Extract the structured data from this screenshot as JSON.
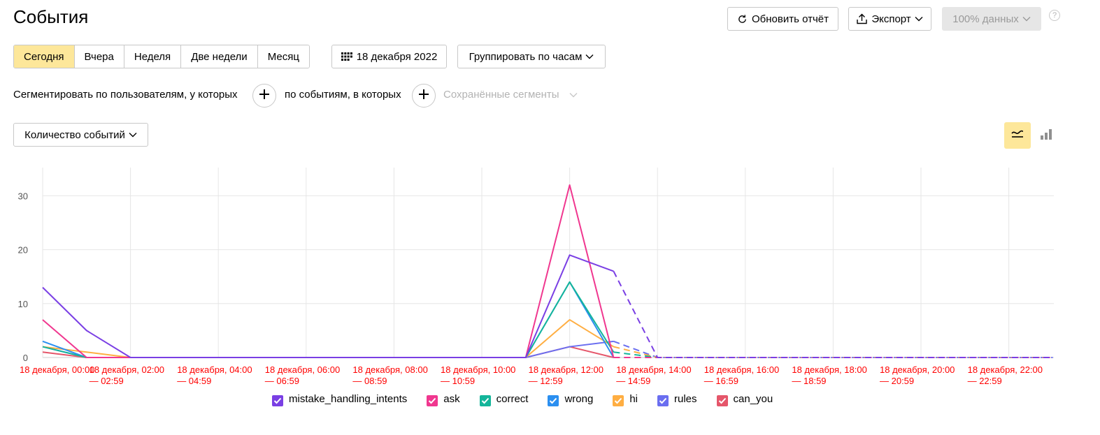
{
  "page_title": "События",
  "header": {
    "refresh_label": "Обновить отчёт",
    "export_label": "Экспорт",
    "sampling_label": "100% данных",
    "help_icon": "?"
  },
  "periods": [
    "Сегодня",
    "Вчера",
    "Неделя",
    "Две недели",
    "Месяц"
  ],
  "active_period": "Сегодня",
  "date_label": "18 декабря 2022",
  "group_label": "Группировать по часам",
  "segment": {
    "users_text": "Сегментировать по пользователям, у которых",
    "events_text": "по событиям, в которых",
    "saved_segments": "Сохранённые сегменты"
  },
  "metric_label": "Количество событий",
  "colors": {
    "accent": "#fde79a",
    "mistake_handling_intents": "#7a3fe4",
    "ask": "#f0378f",
    "correct": "#14b59a",
    "wrong": "#2b8ff0",
    "hi": "#ffae42",
    "rules": "#6a6ef0",
    "can_you": "#e5566a",
    "tick_label": "#ff0000"
  },
  "chart_data": {
    "type": "line",
    "ylim": [
      0,
      35
    ],
    "y_ticks": [
      0,
      10,
      20,
      30
    ],
    "grid": true,
    "legend_position": "bottom",
    "x": [
      0,
      1,
      2,
      3,
      4,
      5,
      6,
      7,
      8,
      9,
      10,
      11,
      12,
      13,
      14,
      15,
      16,
      17,
      18,
      19,
      20,
      21,
      22,
      23
    ],
    "x_tick_labels": [
      [
        "18 декабря, 00:00",
        ""
      ],
      [
        "18 декабря, 02:00",
        "— 02:59"
      ],
      [
        "18 декабря, 04:00",
        "— 04:59"
      ],
      [
        "18 декабря, 06:00",
        "— 06:59"
      ],
      [
        "18 декабря, 08:00",
        "— 08:59"
      ],
      [
        "18 декабря, 10:00",
        "— 10:59"
      ],
      [
        "18 декабря, 12:00",
        "— 12:59"
      ],
      [
        "18 декабря, 14:00",
        "— 14:59"
      ],
      [
        "18 декабря, 16:00",
        "— 16:59"
      ],
      [
        "18 декабря, 18:00",
        "— 18:59"
      ],
      [
        "18 декабря, 20:00",
        "— 20:59"
      ],
      [
        "18 декабря, 22:00",
        "— 22:59"
      ]
    ],
    "dashed_from_index": 13,
    "series": [
      {
        "name": "mistake_handling_intents",
        "values": [
          13,
          5,
          0,
          0,
          0,
          0,
          0,
          0,
          0,
          0,
          0,
          0,
          19,
          16,
          0,
          0,
          0,
          0,
          0,
          0,
          0,
          0,
          0,
          0
        ]
      },
      {
        "name": "ask",
        "values": [
          7,
          0,
          0,
          0,
          0,
          0,
          0,
          0,
          0,
          0,
          0,
          0,
          32,
          0,
          0,
          0,
          0,
          0,
          0,
          0,
          0,
          0,
          0,
          0
        ]
      },
      {
        "name": "correct",
        "values": [
          2,
          0,
          0,
          0,
          0,
          0,
          0,
          0,
          0,
          0,
          0,
          0,
          14,
          1,
          0,
          0,
          0,
          0,
          0,
          0,
          0,
          0,
          0,
          0
        ]
      },
      {
        "name": "wrong",
        "values": [
          3,
          0,
          0,
          0,
          0,
          0,
          0,
          0,
          0,
          0,
          0,
          0,
          14,
          0,
          0,
          0,
          0,
          0,
          0,
          0,
          0,
          0,
          0,
          0
        ]
      },
      {
        "name": "hi",
        "values": [
          2,
          1,
          0,
          0,
          0,
          0,
          0,
          0,
          0,
          0,
          0,
          0,
          7,
          2,
          0,
          0,
          0,
          0,
          0,
          0,
          0,
          0,
          0,
          0
        ]
      },
      {
        "name": "rules",
        "values": [
          2,
          0,
          0,
          0,
          0,
          0,
          0,
          0,
          0,
          0,
          0,
          0,
          2,
          3,
          0,
          0,
          0,
          0,
          0,
          0,
          0,
          0,
          0,
          0
        ]
      },
      {
        "name": "can_you",
        "values": [
          1,
          0,
          0,
          0,
          0,
          0,
          0,
          0,
          0,
          0,
          0,
          0,
          2,
          0,
          0,
          0,
          0,
          0,
          0,
          0,
          0,
          0,
          0,
          0
        ]
      }
    ]
  }
}
